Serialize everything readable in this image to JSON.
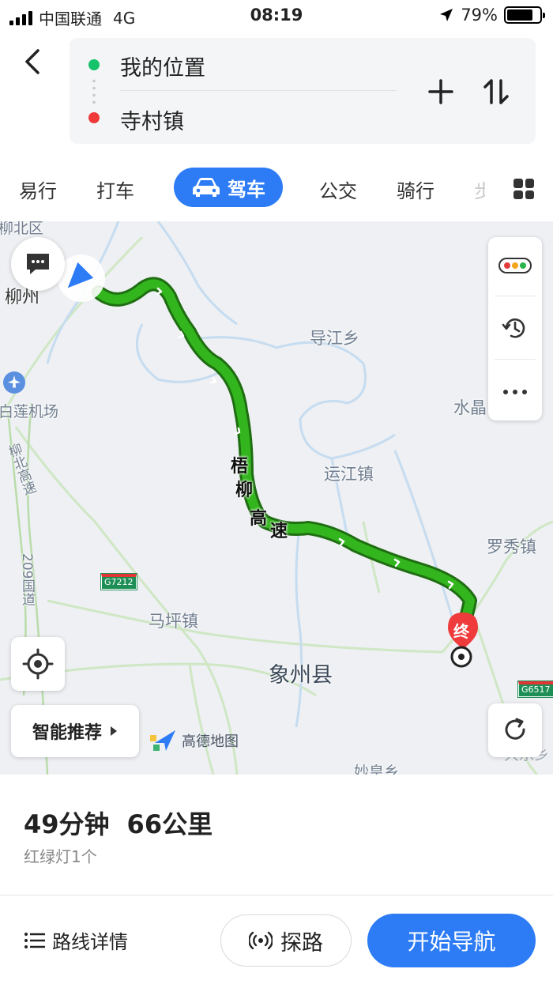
{
  "status_bar": {
    "carrier": "中国联通",
    "network": "4G",
    "time": "08:19",
    "battery_percent": "79%",
    "battery_level": 0.79
  },
  "route_input": {
    "origin": "我的位置",
    "destination": "寺村镇"
  },
  "modes": {
    "tabs": [
      "易行",
      "打车",
      "驾车",
      "公交",
      "骑行",
      "步"
    ],
    "active": "驾车"
  },
  "map": {
    "labels": {
      "liuzhou": "柳州",
      "daojiang": "导江乡",
      "bailian_airport": "白莲机场",
      "shuijing": "水晶",
      "yunjiang": "运江镇",
      "luoxiu": "罗秀镇",
      "maping": "马坪镇",
      "xiangzhou": "象州县",
      "miaohuang": "妙皇乡",
      "liubei_area": "柳北区",
      "liubei_highway": "柳北高速",
      "road_209": "209国道",
      "right_edge": "大乐乡"
    },
    "route_name": [
      "梧",
      "柳",
      "高",
      "速"
    ],
    "shields": {
      "g7212": "G7212",
      "g6517": "G6517"
    },
    "end_marker": "终",
    "recommend_label": "智能推荐",
    "logo_text": "高德地图",
    "colors": {
      "route": "#33b51e",
      "route_border": "#1f6e12",
      "accent": "#2d7cf6"
    }
  },
  "summary": {
    "duration": "49分钟",
    "distance": "66公里",
    "traffic_lights": "红绿灯1个"
  },
  "bottom_bar": {
    "route_detail": "路线详情",
    "explore": "探路",
    "start_nav": "开始导航"
  }
}
